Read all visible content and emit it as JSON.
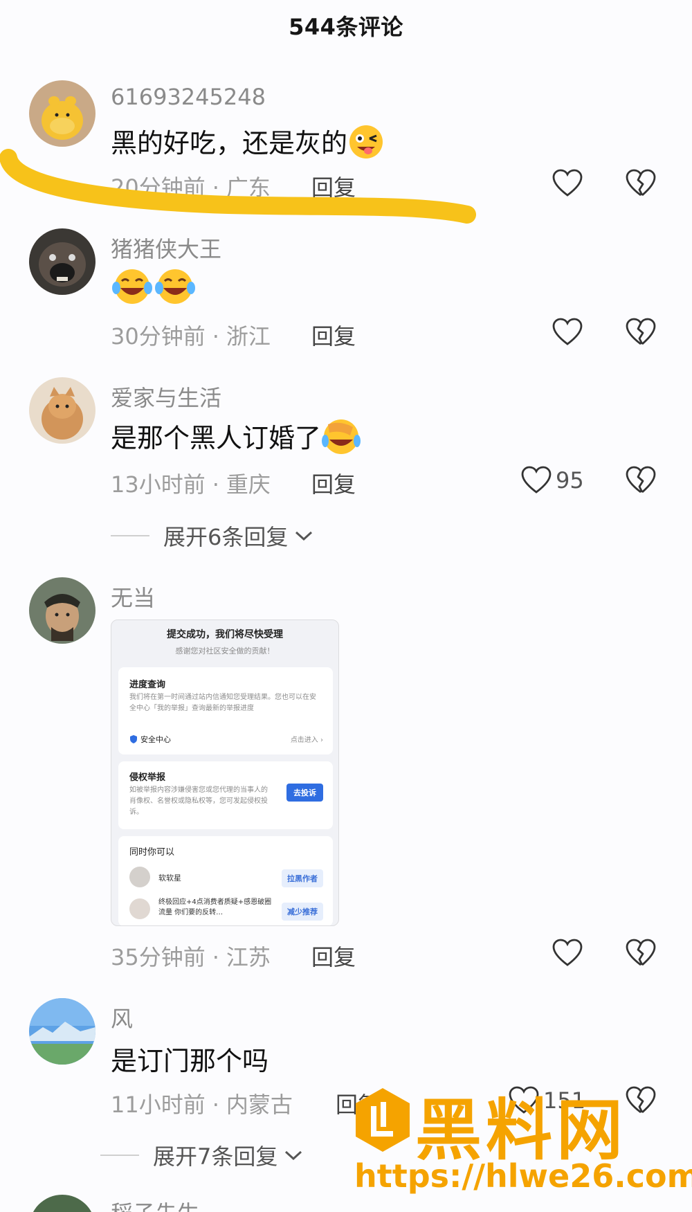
{
  "header": {
    "title": "544条评论"
  },
  "comments": [
    {
      "username": "61693245248",
      "text": "黑的好吃，还是灰的",
      "time": "20分钟前",
      "location": "广东",
      "reply": "回复",
      "likes": ""
    },
    {
      "username": "猪猪侠大王",
      "text": "",
      "time": "30分钟前",
      "location": "浙江",
      "reply": "回复",
      "likes": ""
    },
    {
      "username": "爱家与生活",
      "text": "是那个黑人订婚了",
      "time": "13小时前",
      "location": "重庆",
      "reply": "回复",
      "likes": "95",
      "expand": "展开6条回复"
    },
    {
      "username": "无当",
      "text": "",
      "time": "35分钟前",
      "location": "江苏",
      "reply": "回复",
      "likes": ""
    },
    {
      "username": "风",
      "text": "是订门那个吗",
      "time": "11小时前",
      "location": "内蒙古",
      "reply": "回复",
      "likes": "151",
      "expand": "展开7条回复"
    },
    {
      "username": "稻子先生"
    }
  ],
  "dot": "·",
  "screenshot": {
    "title": "提交成功，我们将尽快受理",
    "subtitle": "感谢您对社区安全做的贡献！",
    "progress_title": "进度查询",
    "progress_text": "我们将在第一时间通过站内信通知您受理结果。您也可以在安全中心「我的举报」查询最新的举报进度",
    "security_center": "安全中心",
    "enter": "点击进入 ›",
    "infringe_title": "侵权举报",
    "infringe_text": "如被举报内容涉嫌侵害您或您代理的当事人的肖像权、名誉权或隐私权等，您可发起侵权投诉。",
    "complain_btn": "去投诉",
    "also_title": "同时你可以",
    "user1": "软软星",
    "block_btn": "拉黑作者",
    "user2_text": "终极回应+4点消费者质疑+感恩破圈流量 你们要的反转…",
    "reduce_btn": "减少推荐"
  },
  "watermark": {
    "brand": "黑料网",
    "url": "https://hlwe26.com"
  },
  "colors": {
    "highlight": "#f7c21a",
    "watermark": "#f5a300"
  }
}
